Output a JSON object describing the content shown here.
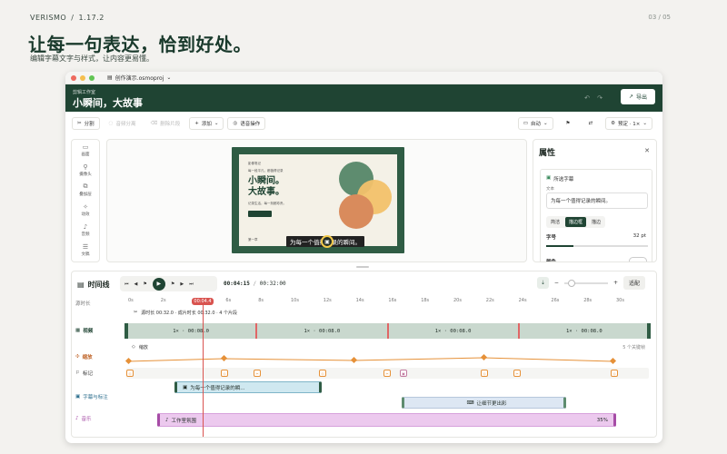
{
  "brand": {
    "name": "VERISMO",
    "sep": "/",
    "version": "1.17.2"
  },
  "page_indicator": "03 / 05",
  "hero": {
    "title": "让每一句表达，恰到好处。",
    "subtitle": "编辑字幕文字与样式，让内容更易懂。"
  },
  "window": {
    "file_name": "创作演示.osmoproj",
    "traffic_colors": [
      "#ee6a5e",
      "#f5bf4f",
      "#61c554"
    ]
  },
  "project": {
    "workspace": "剪辑工作室",
    "title": "小瞬间，大故事",
    "export_label": "导出"
  },
  "toolbar": {
    "split": "分割",
    "detach_audio": "音频分离",
    "delete_clip": "删除片段",
    "add": "添加",
    "voice": "语音操作",
    "auto": "自动",
    "preset": "预定 · 1×"
  },
  "sidebar": [
    {
      "label": "画面",
      "icon": "▭"
    },
    {
      "label": "摄像头",
      "icon": "⚲"
    },
    {
      "label": "叠加层",
      "icon": "⧉"
    },
    {
      "label": "动效",
      "icon": "✧"
    },
    {
      "label": "音频",
      "icon": "♪"
    },
    {
      "label": "文稿",
      "icon": "☰"
    }
  ],
  "slide": {
    "tag": "影像笔记",
    "small": "每一段平凡，都值得记录",
    "title_line1": "小瞬间。",
    "title_line2": "大故事。",
    "desc": "记录生活，每一刻都珍贵。",
    "footer": "第一章",
    "caption": "为每一个值得记录的瞬间。"
  },
  "props": {
    "title": "属性",
    "selected": "所选字幕",
    "text_label": "文本",
    "text_value": "为每一个值得记录的瞬间。",
    "style_options": [
      "简洁",
      "描边框",
      "描边"
    ],
    "active_style": "描边框",
    "size_label": "字号",
    "size_value": "32 pt",
    "color_label": "颜色"
  },
  "timeline": {
    "title": "时间线",
    "current_time": "00:04:15",
    "total_time": "00:32:00",
    "fit_label": "适配",
    "playhead": "00:04.4",
    "ruler": [
      "0s",
      "2s",
      "4s",
      "6s",
      "8s",
      "10s",
      "12s",
      "14s",
      "16s",
      "18s",
      "20s",
      "22s",
      "24s",
      "26s",
      "28s",
      "30s"
    ],
    "strip_info": "源时长 00:32.0 · 成片时长 00:32.0 · 4 个片段",
    "segments": [
      "1× · 00:08.0",
      "1× · 00:08.0",
      "1× · 00:08.0",
      "1× · 00:08.0"
    ],
    "keyframe_label": "缩放",
    "keyframe_count": "5 个关键帧",
    "tracks": {
      "source": "源时长",
      "video": "视频",
      "zoom": "缩放",
      "marker": "标记",
      "caption": "字幕与标注",
      "music": "音乐"
    },
    "caption_clip": "为每一个值得记录的瞬...",
    "callout_clip": "让细节更出彩",
    "music_clip": "工作室氛围",
    "music_volume": "35%"
  },
  "colors": {
    "brand_green": "#1f4433",
    "playhead": "#d9534f",
    "video_track": "#c9d8ce",
    "keyframe": "#e69138",
    "caption_clip": "#cfe8f0",
    "music_clip": "#ecc9ee"
  }
}
